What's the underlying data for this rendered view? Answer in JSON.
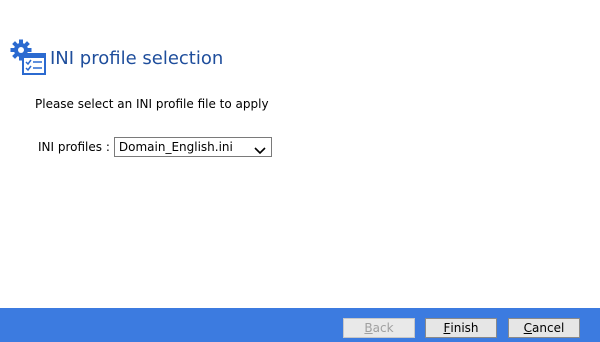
{
  "header": {
    "title": "INI profile selection",
    "icon": "settings-checklist-icon"
  },
  "instruction": "Please select an INI profile file to apply",
  "ini_field": {
    "label": "INI profiles :",
    "selected": "Domain_English.ini"
  },
  "buttons": {
    "back": {
      "first": "B",
      "rest": "ack",
      "enabled": false
    },
    "finish": {
      "first": "F",
      "rest": "inish",
      "enabled": true
    },
    "cancel": {
      "first": "C",
      "rest": "ancel",
      "enabled": true
    }
  },
  "colors": {
    "title": "#1f4e9c",
    "footer": "#3c7be0",
    "icon_blue": "#2b6ad0"
  }
}
